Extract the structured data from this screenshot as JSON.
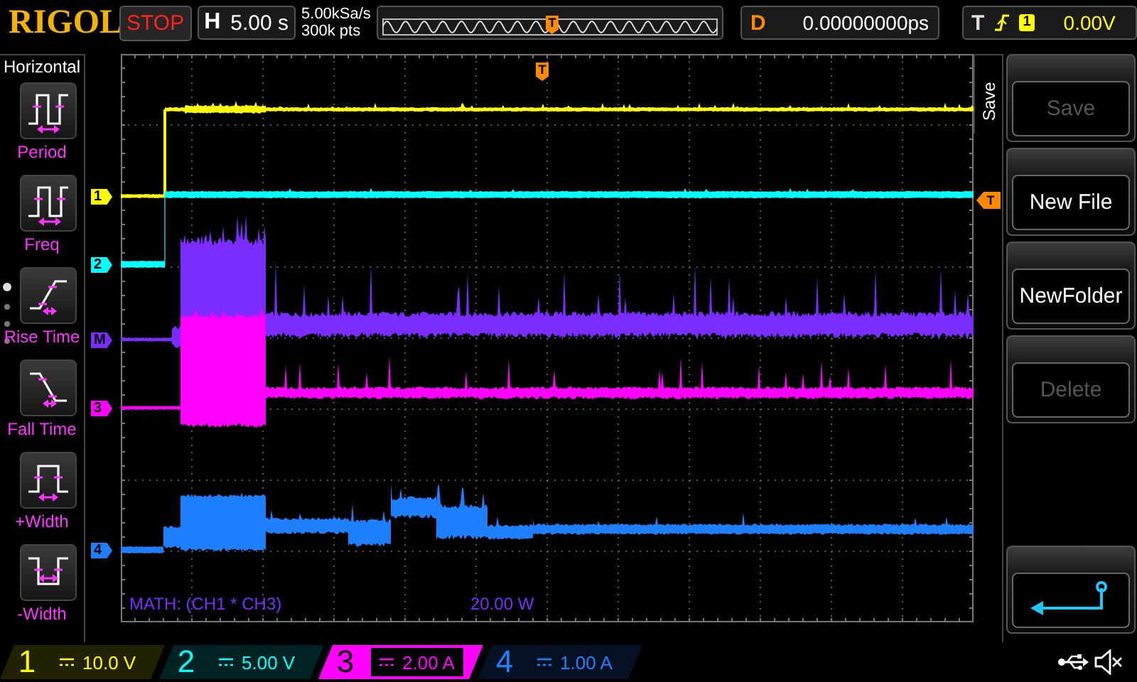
{
  "brand": "RIGOL",
  "run_state": {
    "label": "STOP"
  },
  "timebase": {
    "label": "H",
    "value": "5.00 s"
  },
  "acquisition": {
    "sample_rate": "5.00kSa/s",
    "memory_depth": "300k pts"
  },
  "overview": {
    "marker": "T"
  },
  "delay": {
    "label": "D",
    "value": "0.00000000ps"
  },
  "trigger": {
    "label": "T",
    "source": "1",
    "level": "0.00V"
  },
  "measure_menu": {
    "title": "Horizontal",
    "items": [
      {
        "label": "Period",
        "kind": "period"
      },
      {
        "label": "Freq",
        "kind": "freq"
      },
      {
        "label": "Rise Time",
        "kind": "rise"
      },
      {
        "label": "Fall Time",
        "kind": "fall"
      },
      {
        "label": "+Width",
        "kind": "pwidth"
      },
      {
        "label": "-Width",
        "kind": "nwidth"
      }
    ]
  },
  "channel_markers": [
    {
      "label": "1",
      "color": "#ffff00"
    },
    {
      "label": "2",
      "color": "#00ffff"
    },
    {
      "label": "M",
      "color": "#7b2cff"
    },
    {
      "label": "3",
      "color": "#ff00ff"
    },
    {
      "label": "4",
      "color": "#1e7fff"
    }
  ],
  "trigger_time_marker": "T",
  "trigger_level_marker": "T",
  "math": {
    "expression": "MATH: (CH1 * CH3)",
    "scale": "20.00 W"
  },
  "save_menu": {
    "title": "Save",
    "buttons": [
      {
        "label": "Save",
        "kind": "text",
        "disabled": true
      },
      {
        "label": "New File",
        "kind": "text",
        "disabled": false
      },
      {
        "label": "NewFolder",
        "kind": "text",
        "disabled": false
      },
      {
        "label": "Delete",
        "kind": "text",
        "disabled": true
      },
      {
        "kind": "back",
        "disabled": false
      }
    ]
  },
  "channels": [
    {
      "number": "1",
      "scale": "10.0 V",
      "color": "#ffff00",
      "selected": false
    },
    {
      "number": "2",
      "scale": "5.00 V",
      "color": "#00ffff",
      "selected": false
    },
    {
      "number": "3",
      "scale": "2.00 A",
      "color": "#ff00ff",
      "selected": true
    },
    {
      "number": "4",
      "scale": "1.00 A",
      "color": "#1e7fff",
      "selected": false
    }
  ]
}
